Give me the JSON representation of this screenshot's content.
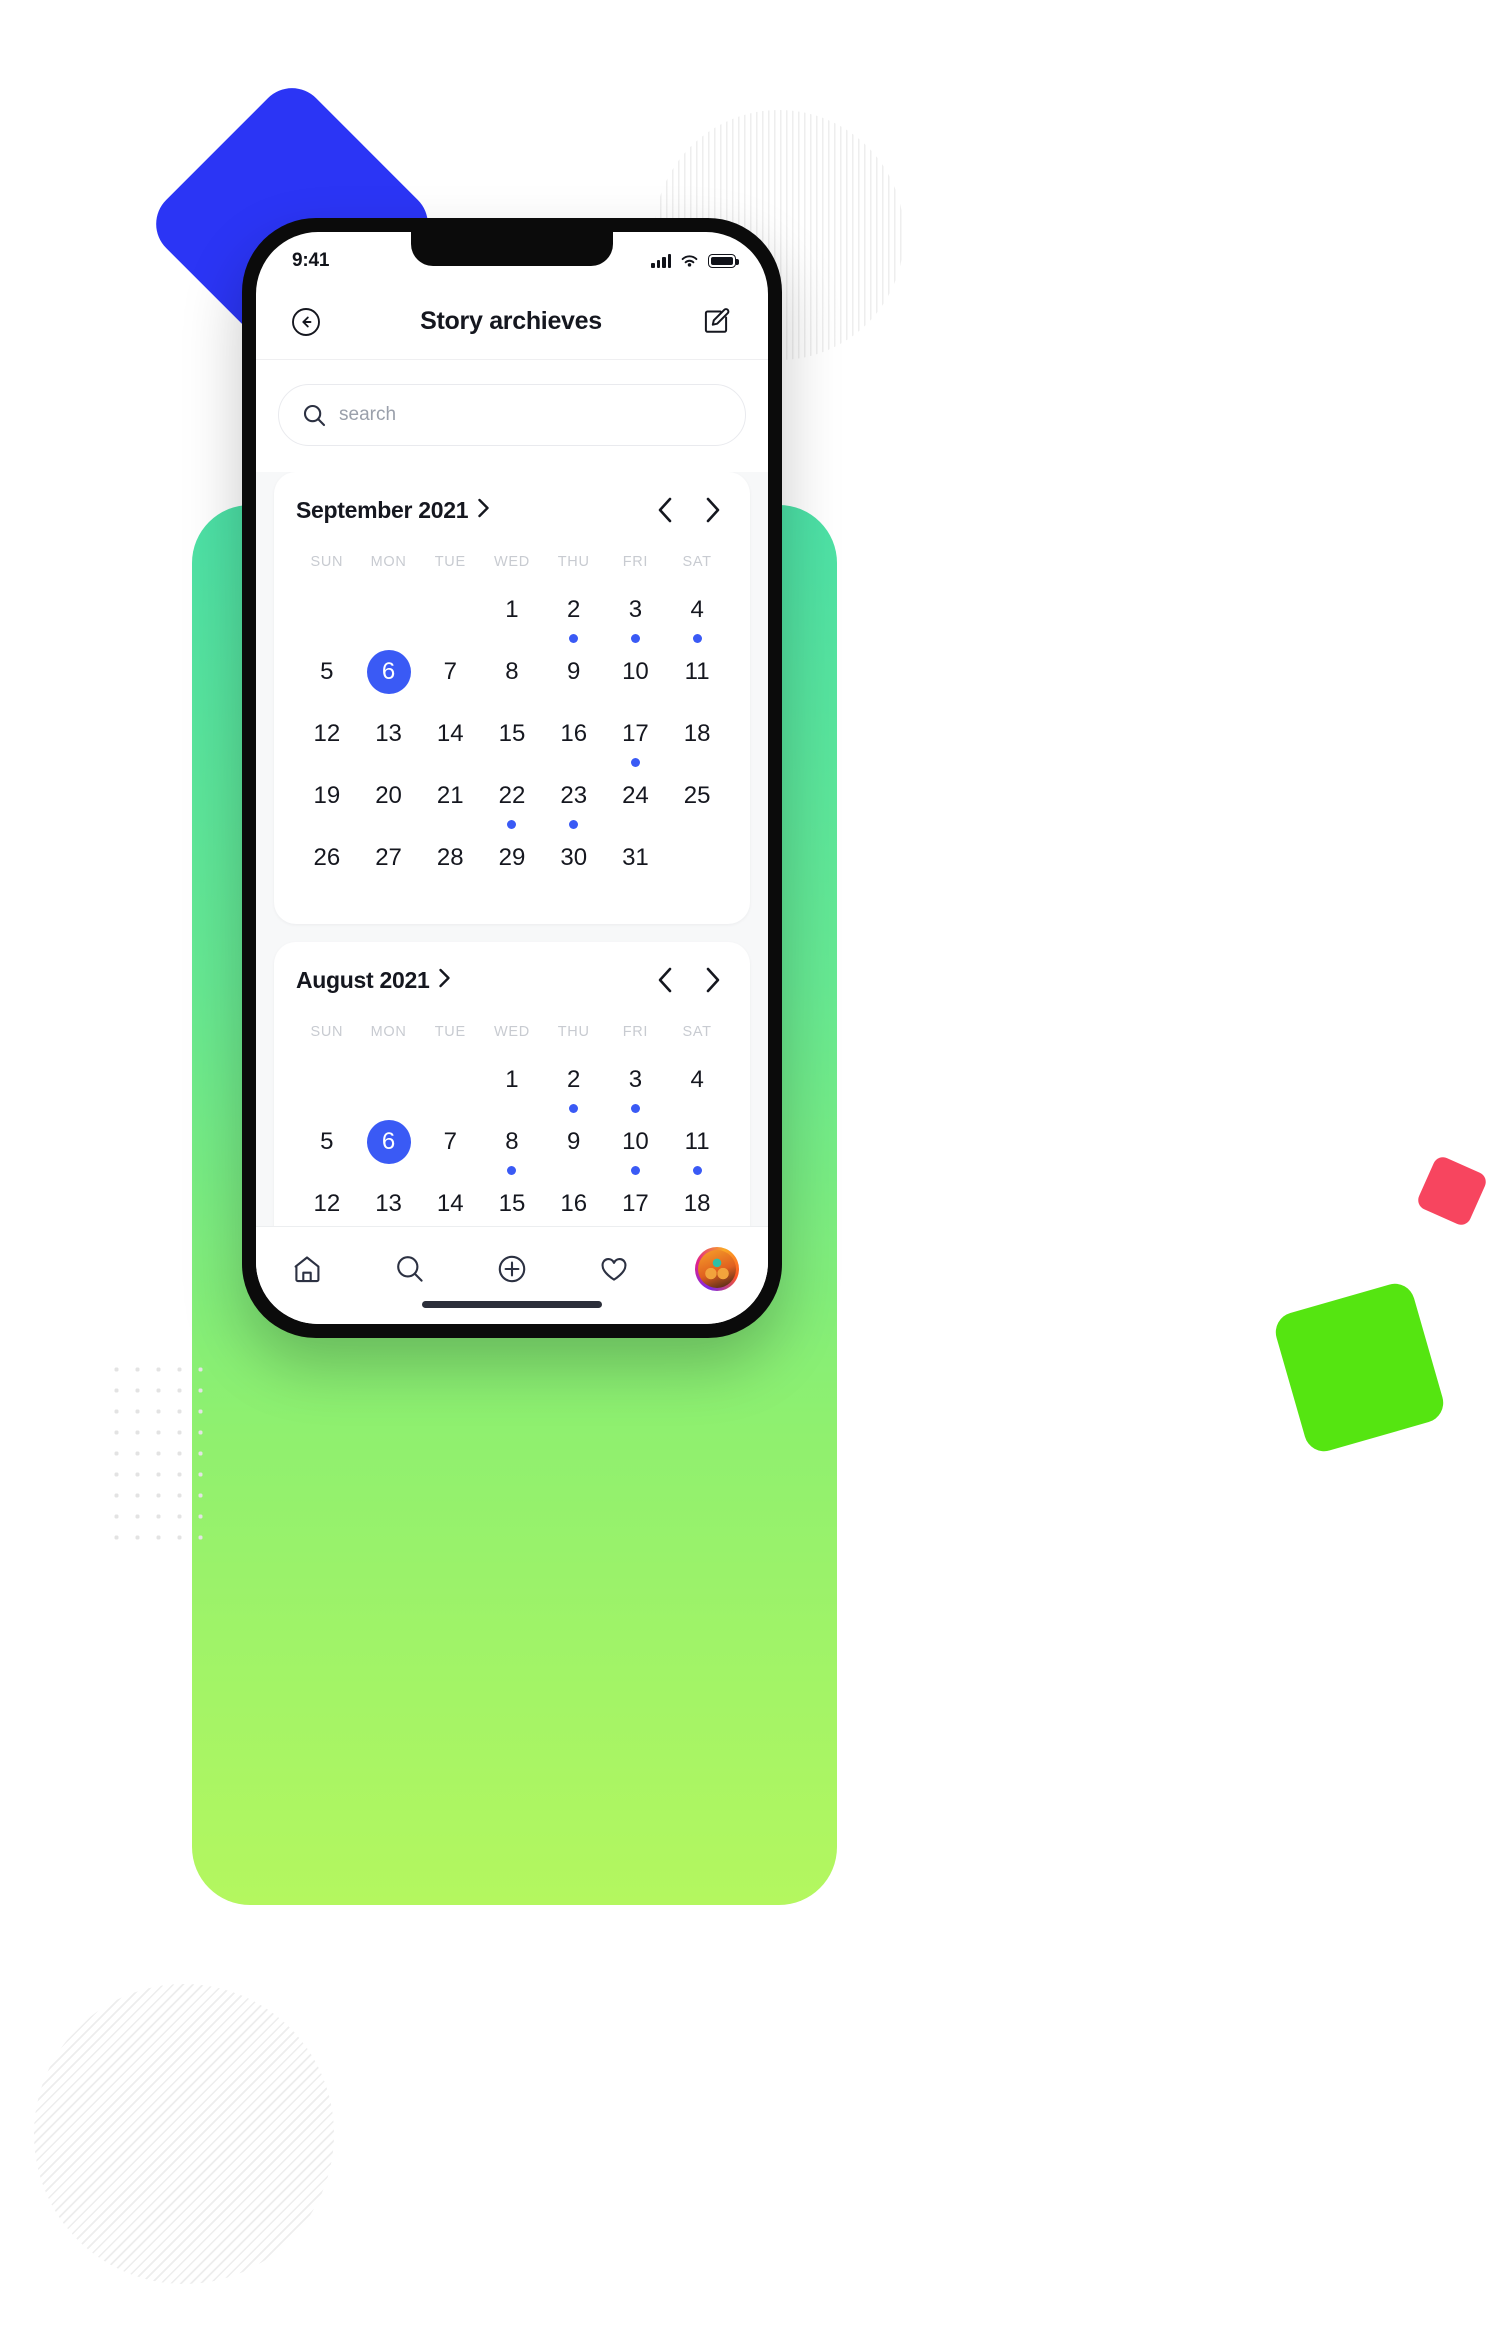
{
  "colors": {
    "accent_blue": "#3A5AF5",
    "deco_blue": "#2B35F5",
    "deco_pink": "#F7455F",
    "deco_green": "#55E511",
    "gradient_top": "#4CE0A6",
    "gradient_bottom": "#B4F75F"
  },
  "status_bar": {
    "time": "9:41",
    "signal_icon": "cellular-signal-icon",
    "wifi_icon": "wifi-icon",
    "battery_icon": "battery-icon"
  },
  "header": {
    "back_icon": "back-arrow-circle-icon",
    "title": "Story archieves",
    "compose_icon": "compose-edit-icon"
  },
  "search": {
    "icon": "search-icon",
    "placeholder": "search",
    "value": ""
  },
  "weekdays": [
    "SUN",
    "MON",
    "TUE",
    "WED",
    "THU",
    "FRI",
    "SAT"
  ],
  "calendars": [
    {
      "title": "September 2021",
      "title_chevron_icon": "chevron-right-icon",
      "prev_icon": "chevron-left-icon",
      "next_icon": "chevron-right-icon",
      "lead_blanks": 3,
      "days": [
        {
          "n": "1",
          "dot": false,
          "selected": false
        },
        {
          "n": "2",
          "dot": true,
          "selected": false
        },
        {
          "n": "3",
          "dot": true,
          "selected": false
        },
        {
          "n": "4",
          "dot": true,
          "selected": false
        },
        {
          "n": "5",
          "dot": false,
          "selected": false
        },
        {
          "n": "6",
          "dot": false,
          "selected": true
        },
        {
          "n": "7",
          "dot": false,
          "selected": false
        },
        {
          "n": "8",
          "dot": false,
          "selected": false
        },
        {
          "n": "9",
          "dot": false,
          "selected": false
        },
        {
          "n": "10",
          "dot": false,
          "selected": false
        },
        {
          "n": "11",
          "dot": false,
          "selected": false
        },
        {
          "n": "12",
          "dot": false,
          "selected": false
        },
        {
          "n": "13",
          "dot": false,
          "selected": false
        },
        {
          "n": "14",
          "dot": false,
          "selected": false
        },
        {
          "n": "15",
          "dot": false,
          "selected": false
        },
        {
          "n": "16",
          "dot": false,
          "selected": false
        },
        {
          "n": "17",
          "dot": true,
          "selected": false
        },
        {
          "n": "18",
          "dot": false,
          "selected": false
        },
        {
          "n": "19",
          "dot": false,
          "selected": false
        },
        {
          "n": "20",
          "dot": false,
          "selected": false
        },
        {
          "n": "21",
          "dot": false,
          "selected": false
        },
        {
          "n": "22",
          "dot": true,
          "selected": false
        },
        {
          "n": "23",
          "dot": true,
          "selected": false
        },
        {
          "n": "24",
          "dot": false,
          "selected": false
        },
        {
          "n": "25",
          "dot": false,
          "selected": false
        },
        {
          "n": "26",
          "dot": false,
          "selected": false
        },
        {
          "n": "27",
          "dot": false,
          "selected": false
        },
        {
          "n": "28",
          "dot": false,
          "selected": false
        },
        {
          "n": "29",
          "dot": false,
          "selected": false
        },
        {
          "n": "30",
          "dot": false,
          "selected": false
        },
        {
          "n": "31",
          "dot": false,
          "selected": false
        }
      ]
    },
    {
      "title": "August 2021",
      "title_chevron_icon": "chevron-right-icon",
      "prev_icon": "chevron-left-icon",
      "next_icon": "chevron-right-icon",
      "lead_blanks": 3,
      "days": [
        {
          "n": "1",
          "dot": false,
          "selected": false
        },
        {
          "n": "2",
          "dot": true,
          "selected": false
        },
        {
          "n": "3",
          "dot": true,
          "selected": false
        },
        {
          "n": "4",
          "dot": false,
          "selected": false
        },
        {
          "n": "5",
          "dot": false,
          "selected": false
        },
        {
          "n": "6",
          "dot": false,
          "selected": true
        },
        {
          "n": "7",
          "dot": false,
          "selected": false
        },
        {
          "n": "8",
          "dot": true,
          "selected": false
        },
        {
          "n": "9",
          "dot": false,
          "selected": false
        },
        {
          "n": "10",
          "dot": true,
          "selected": false
        },
        {
          "n": "11",
          "dot": true,
          "selected": false
        },
        {
          "n": "12",
          "dot": false,
          "selected": false
        },
        {
          "n": "13",
          "dot": false,
          "selected": false
        },
        {
          "n": "14",
          "dot": false,
          "selected": false
        },
        {
          "n": "15",
          "dot": false,
          "selected": false
        },
        {
          "n": "16",
          "dot": false,
          "selected": false
        },
        {
          "n": "17",
          "dot": false,
          "selected": false
        },
        {
          "n": "18",
          "dot": false,
          "selected": false
        }
      ]
    }
  ],
  "tabbar": {
    "items": [
      {
        "icon": "home-icon",
        "label": "Home"
      },
      {
        "icon": "search-icon",
        "label": "Search"
      },
      {
        "icon": "plus-circle-icon",
        "label": "Create"
      },
      {
        "icon": "heart-icon",
        "label": "Activity"
      },
      {
        "icon": "avatar",
        "label": "Profile"
      }
    ]
  }
}
